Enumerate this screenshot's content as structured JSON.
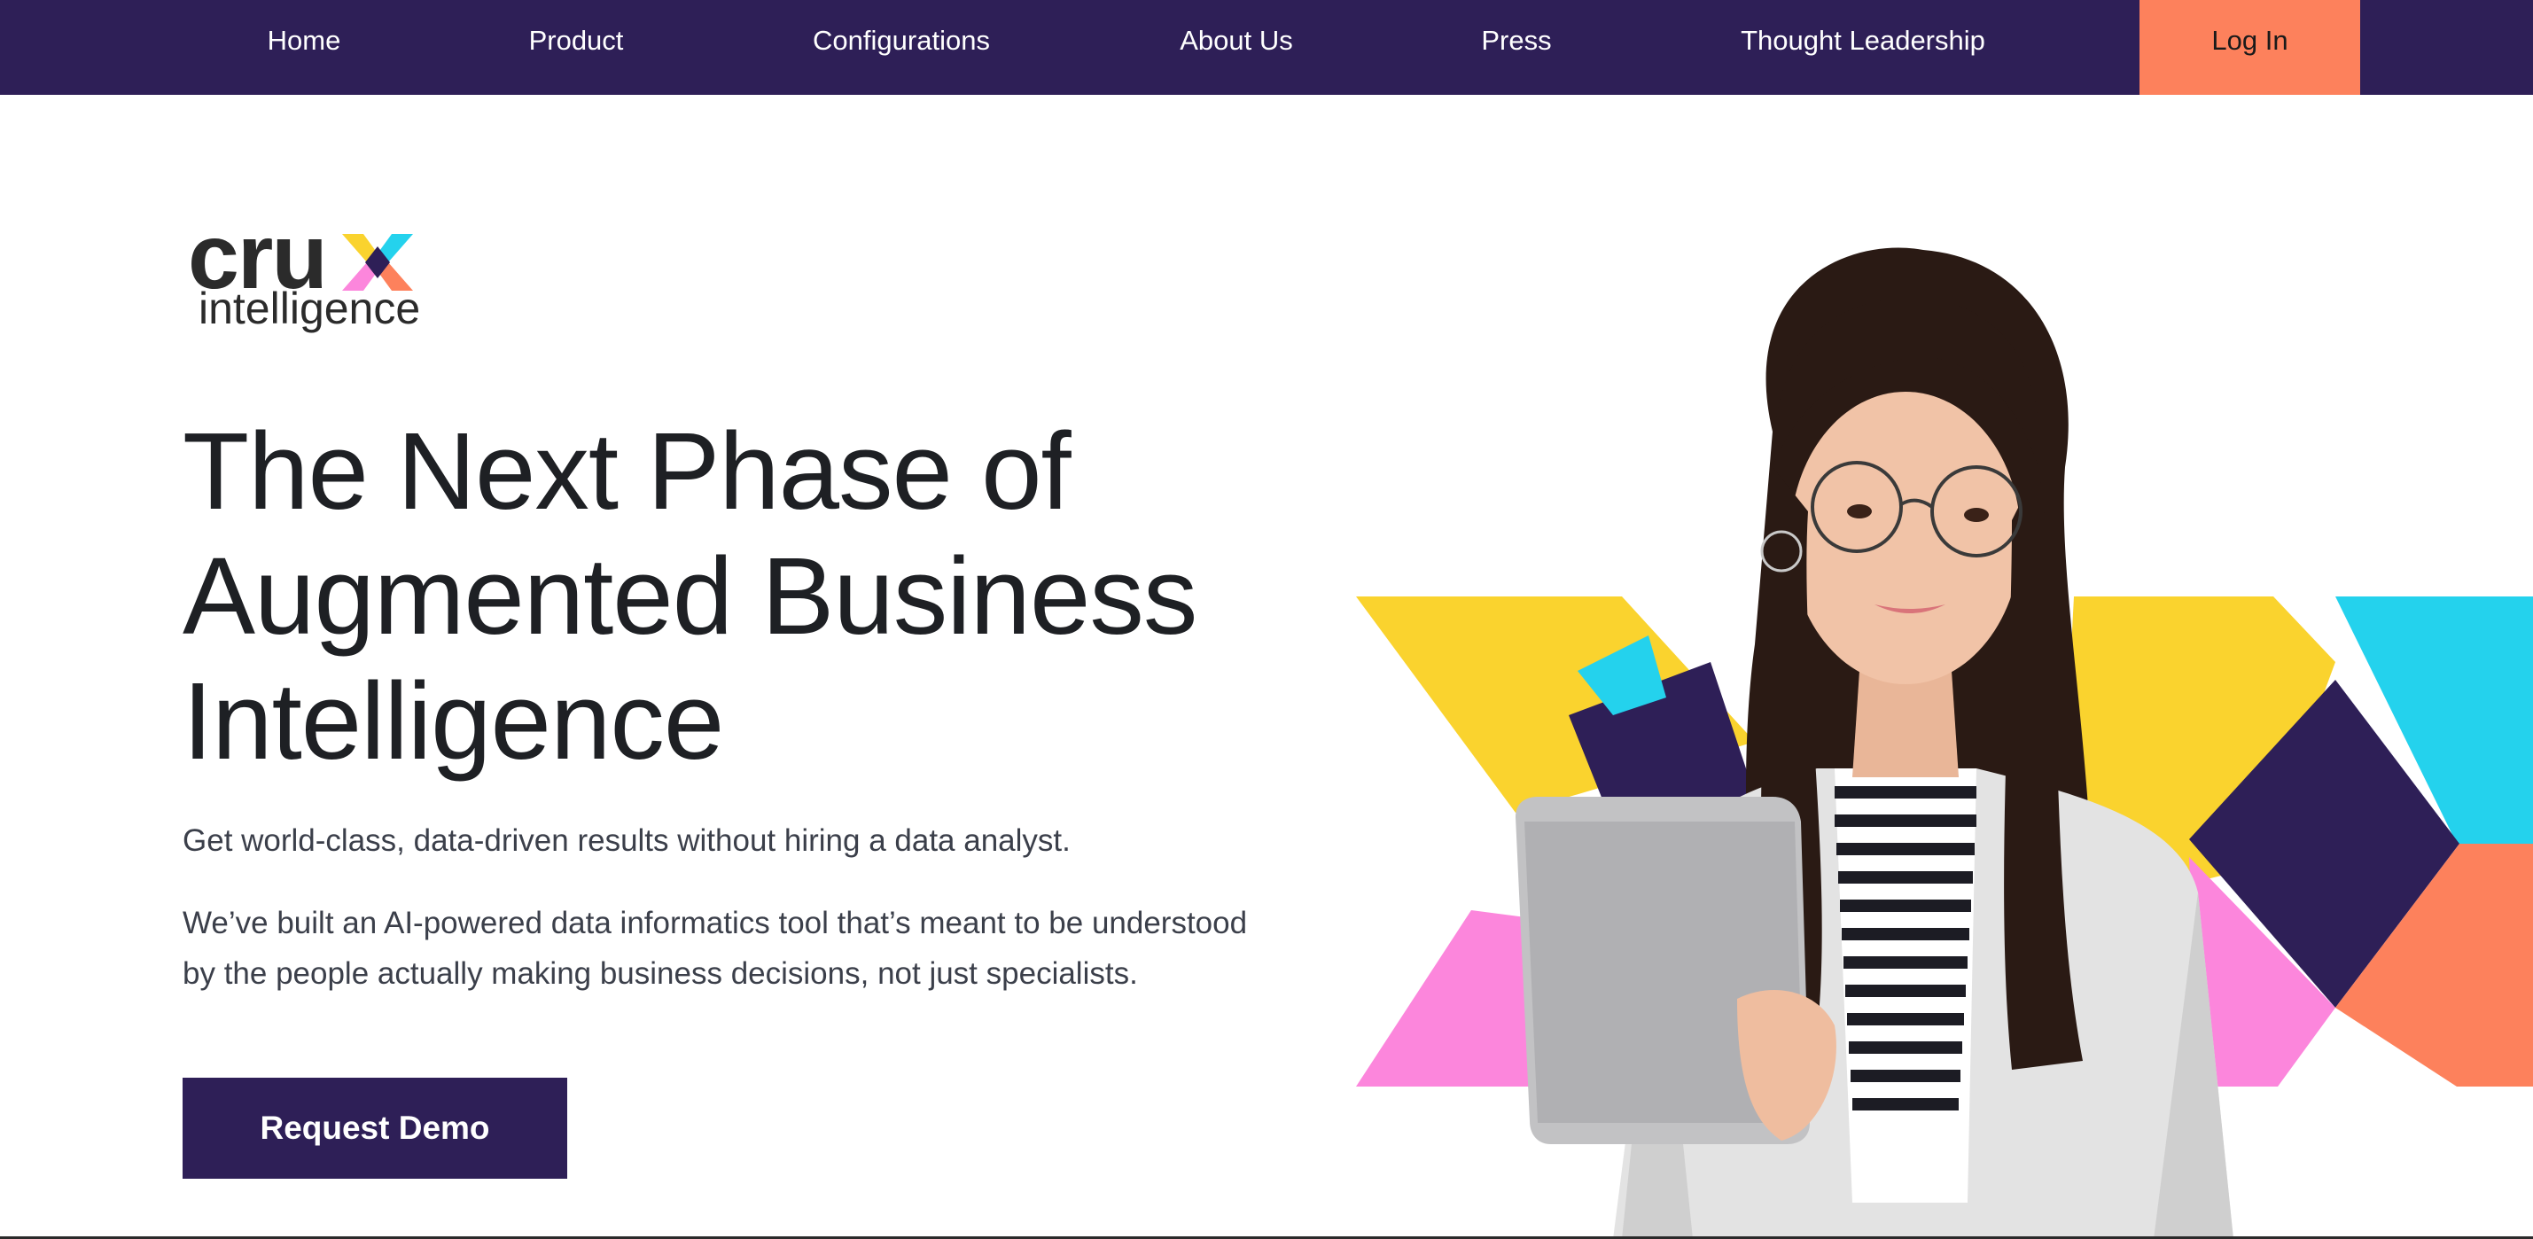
{
  "nav": {
    "items": [
      {
        "label": "Home"
      },
      {
        "label": "Product"
      },
      {
        "label": "Configurations"
      },
      {
        "label": "About Us"
      },
      {
        "label": "Press"
      },
      {
        "label": "Thought Leadership"
      }
    ],
    "login_label": "Log In"
  },
  "logo": {
    "word": "cru",
    "sub": "intelligence"
  },
  "hero": {
    "headline_lines": [
      "The Next Phase of",
      "Augmented Business",
      "Intelligence"
    ],
    "subhead": "Get world-class, data-driven results without hiring a data analyst.",
    "body_lines": [
      "We’ve built an AI-powered data informatics tool that’s meant to be understood",
      "by the people actually making business decisions, not just specialists."
    ],
    "cta_label": "Request Demo"
  },
  "colors": {
    "nav_bg": "#2e1f57",
    "login_bg": "#fd815c",
    "yellow": "#fad32e",
    "cyan": "#24d2ed",
    "pink": "#fc86dc",
    "coral": "#fd815c",
    "purple": "#2e1f57"
  },
  "icons": {
    "logo_mark": "crux-x-logo-icon"
  }
}
